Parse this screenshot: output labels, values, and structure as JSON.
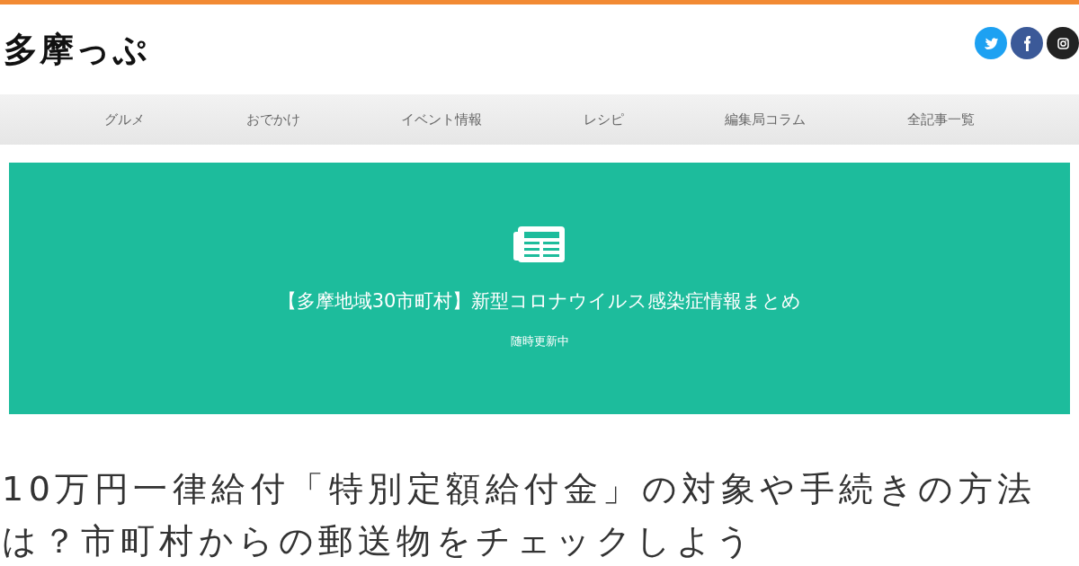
{
  "site": {
    "logo": "多摩っぷ"
  },
  "social": [
    {
      "kind": "twitter",
      "color": "#1da1f2"
    },
    {
      "kind": "facebook",
      "color": "#3b5998"
    },
    {
      "kind": "instagram",
      "color": "#222222"
    }
  ],
  "nav": [
    "グルメ",
    "おでかけ",
    "イベント情報",
    "レシピ",
    "編集局コラム",
    "全記事一覧"
  ],
  "banner": {
    "title": "【多摩地域30市町村】新型コロナウイルス感染症情報まとめ",
    "subtitle": "随時更新中"
  },
  "article": {
    "title": "10万円一律給付「特別定額給付金」の対象や手続きの方法は？市町村からの郵送物をチェックしよう"
  }
}
